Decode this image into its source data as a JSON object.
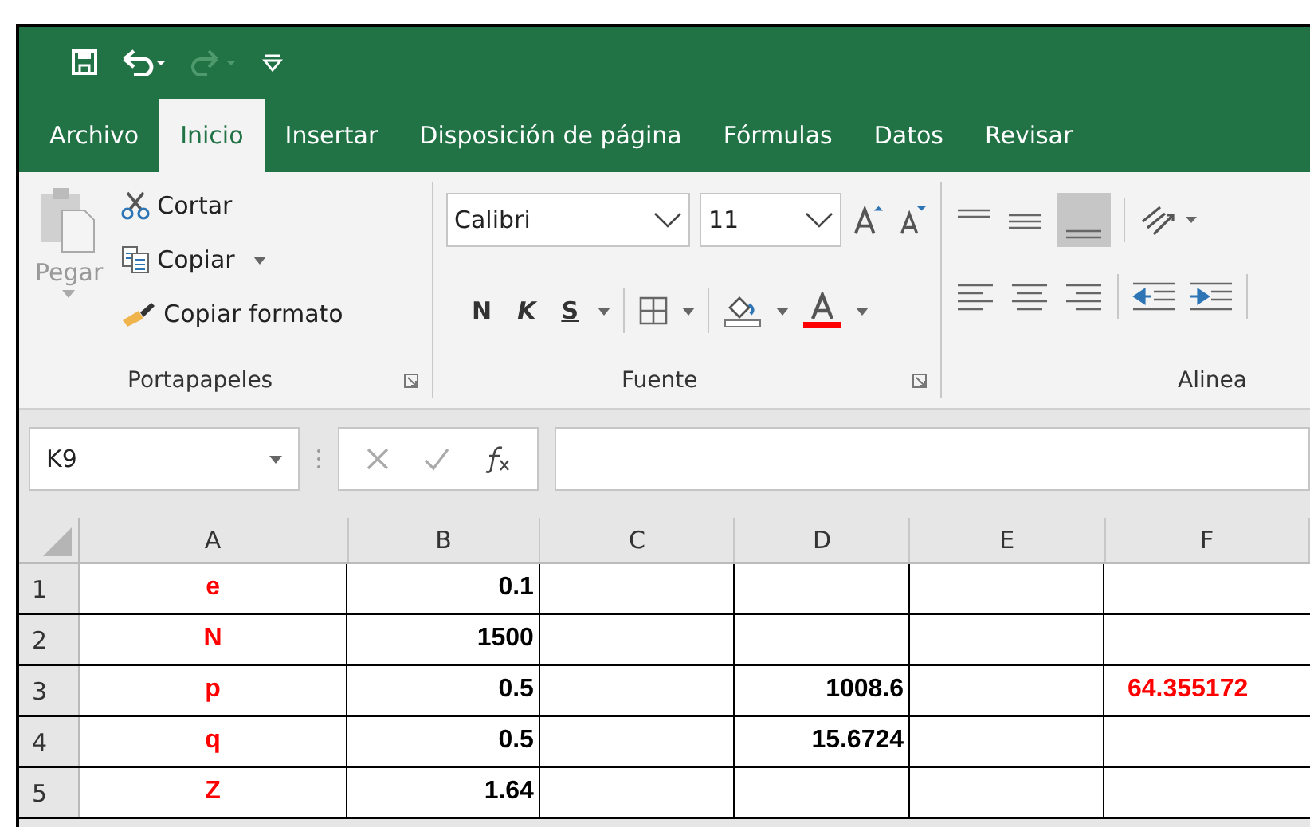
{
  "tabs": [
    {
      "label": "Archivo",
      "selected": false
    },
    {
      "label": "Inicio",
      "selected": true
    },
    {
      "label": "Insertar",
      "selected": false
    },
    {
      "label": "Disposición de página",
      "selected": false
    },
    {
      "label": "Fórmulas",
      "selected": false
    },
    {
      "label": "Datos",
      "selected": false
    },
    {
      "label": "Revisar",
      "selected": false
    }
  ],
  "clipboard": {
    "paste": "Pegar",
    "cut": "Cortar",
    "copy": "Copiar",
    "format_painter": "Copiar formato",
    "group": "Portapapeles"
  },
  "font": {
    "name": "Calibri",
    "size": "11",
    "bold": "N",
    "italic": "K",
    "underline": "S",
    "group": "Fuente"
  },
  "alignment": {
    "group": "Alinea"
  },
  "name_box": "K9",
  "columns": [
    "A",
    "B",
    "C",
    "D",
    "E",
    "F"
  ],
  "rows": [
    {
      "number": "1",
      "cells": [
        {
          "text": "e",
          "color": "#ff0000"
        },
        {
          "text": "0.1",
          "color": "#000000"
        },
        null,
        null,
        null,
        null
      ]
    },
    {
      "number": "2",
      "cells": [
        {
          "text": "N",
          "color": "#ff0000"
        },
        {
          "text": "1500",
          "color": "#000000"
        },
        null,
        null,
        null,
        null
      ]
    },
    {
      "number": "3",
      "cells": [
        {
          "text": "p",
          "color": "#ff0000"
        },
        {
          "text": "0.5",
          "color": "#000000"
        },
        null,
        {
          "text": "1008.6",
          "color": "#000000"
        },
        null,
        {
          "text": "64.355172",
          "color": "#ff0000"
        }
      ]
    },
    {
      "number": "4",
      "cells": [
        {
          "text": "q",
          "color": "#ff0000"
        },
        {
          "text": "0.5",
          "color": "#000000"
        },
        null,
        {
          "text": "15.6724",
          "color": "#000000"
        },
        null,
        null
      ]
    },
    {
      "number": "5",
      "cells": [
        {
          "text": "Z",
          "color": "#ff0000"
        },
        {
          "text": "1.64",
          "color": "#000000"
        },
        null,
        null,
        null,
        null
      ]
    }
  ]
}
